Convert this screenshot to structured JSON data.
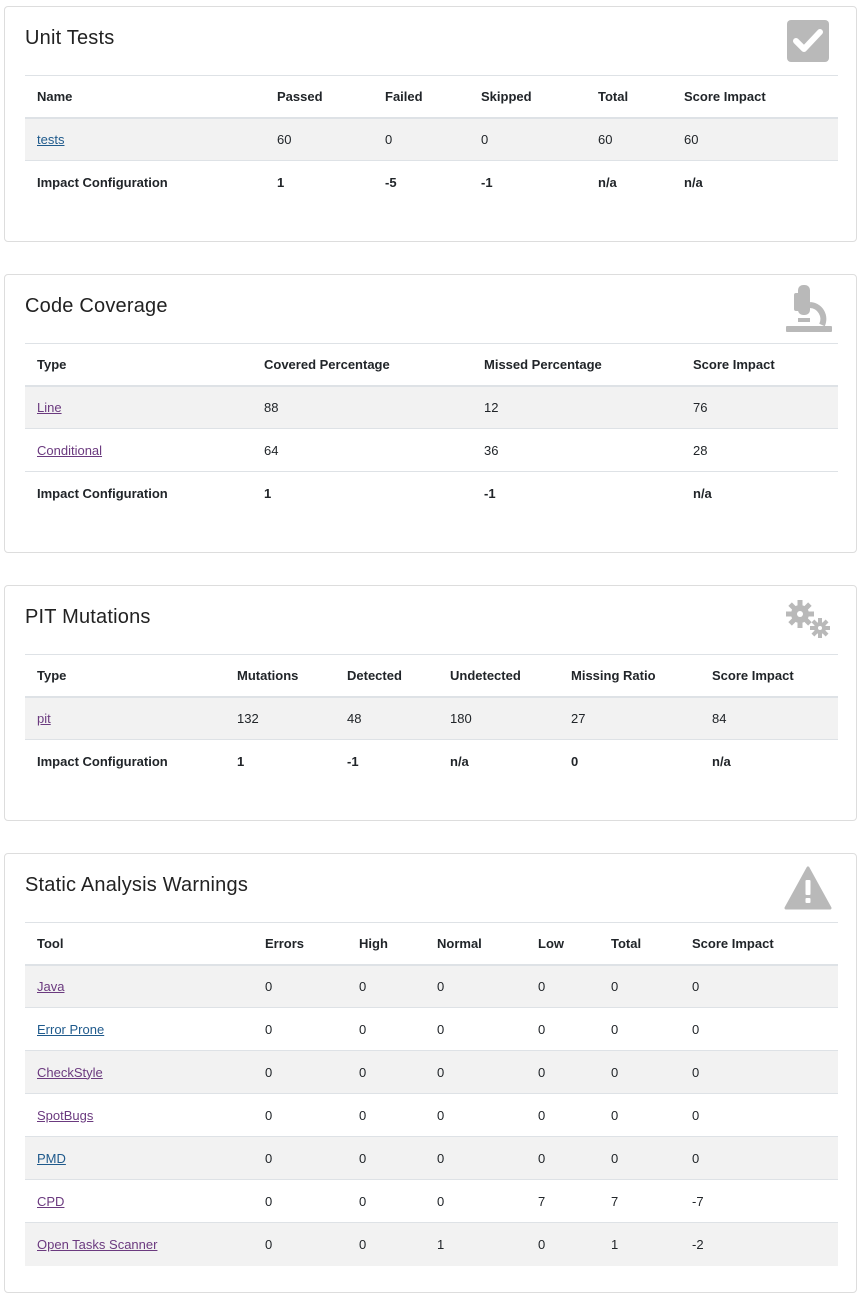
{
  "unit_tests": {
    "title": "Unit Tests",
    "icon": "checkbox-icon",
    "columns": [
      "Name",
      "Passed",
      "Failed",
      "Skipped",
      "Total",
      "Score Impact"
    ],
    "rows": [
      {
        "name": "tests",
        "passed": "60",
        "failed": "0",
        "skipped": "0",
        "total": "60",
        "impact": "60"
      }
    ],
    "impact": {
      "label": "Impact Configuration",
      "passed": "1",
      "failed": "-5",
      "skipped": "-1",
      "total": "n/a",
      "impact": "n/a"
    }
  },
  "coverage": {
    "title": "Code Coverage",
    "icon": "microscope-icon",
    "columns": [
      "Type",
      "Covered Percentage",
      "Missed Percentage",
      "Score Impact"
    ],
    "rows": [
      {
        "name": "Line",
        "covered": "88",
        "missed": "12",
        "impact": "76"
      },
      {
        "name": "Conditional",
        "covered": "64",
        "missed": "36",
        "impact": "28"
      }
    ],
    "impact": {
      "label": "Impact Configuration",
      "covered": "1",
      "missed": "-1",
      "impact": "n/a"
    }
  },
  "pit": {
    "title": "PIT Mutations",
    "icon": "gears-icon",
    "columns": [
      "Type",
      "Mutations",
      "Detected",
      "Undetected",
      "Missing Ratio",
      "Score Impact"
    ],
    "rows": [
      {
        "name": "pit",
        "mutations": "132",
        "detected": "48",
        "undetected": "180",
        "ratio": "27",
        "impact": "84"
      }
    ],
    "impact": {
      "label": "Impact Configuration",
      "mutations": "1",
      "detected": "-1",
      "undetected": "n/a",
      "ratio": "0",
      "impact": "n/a"
    }
  },
  "static": {
    "title": "Static Analysis Warnings",
    "icon": "warning-icon",
    "columns": [
      "Tool",
      "Errors",
      "High",
      "Normal",
      "Low",
      "Total",
      "Score Impact"
    ],
    "rows": [
      {
        "name": "Java",
        "errors": "0",
        "high": "0",
        "normal": "0",
        "low": "0",
        "total": "0",
        "impact": "0"
      },
      {
        "name": "Error Prone",
        "errors": "0",
        "high": "0",
        "normal": "0",
        "low": "0",
        "total": "0",
        "impact": "0"
      },
      {
        "name": "CheckStyle",
        "errors": "0",
        "high": "0",
        "normal": "0",
        "low": "0",
        "total": "0",
        "impact": "0"
      },
      {
        "name": "SpotBugs",
        "errors": "0",
        "high": "0",
        "normal": "0",
        "low": "0",
        "total": "0",
        "impact": "0"
      },
      {
        "name": "PMD",
        "errors": "0",
        "high": "0",
        "normal": "0",
        "low": "0",
        "total": "0",
        "impact": "0"
      },
      {
        "name": "CPD",
        "errors": "0",
        "high": "0",
        "normal": "0",
        "low": "7",
        "total": "7",
        "impact": "-7"
      },
      {
        "name": "Open Tasks Scanner",
        "errors": "0",
        "high": "0",
        "normal": "1",
        "low": "0",
        "total": "1",
        "impact": "-2"
      }
    ]
  }
}
